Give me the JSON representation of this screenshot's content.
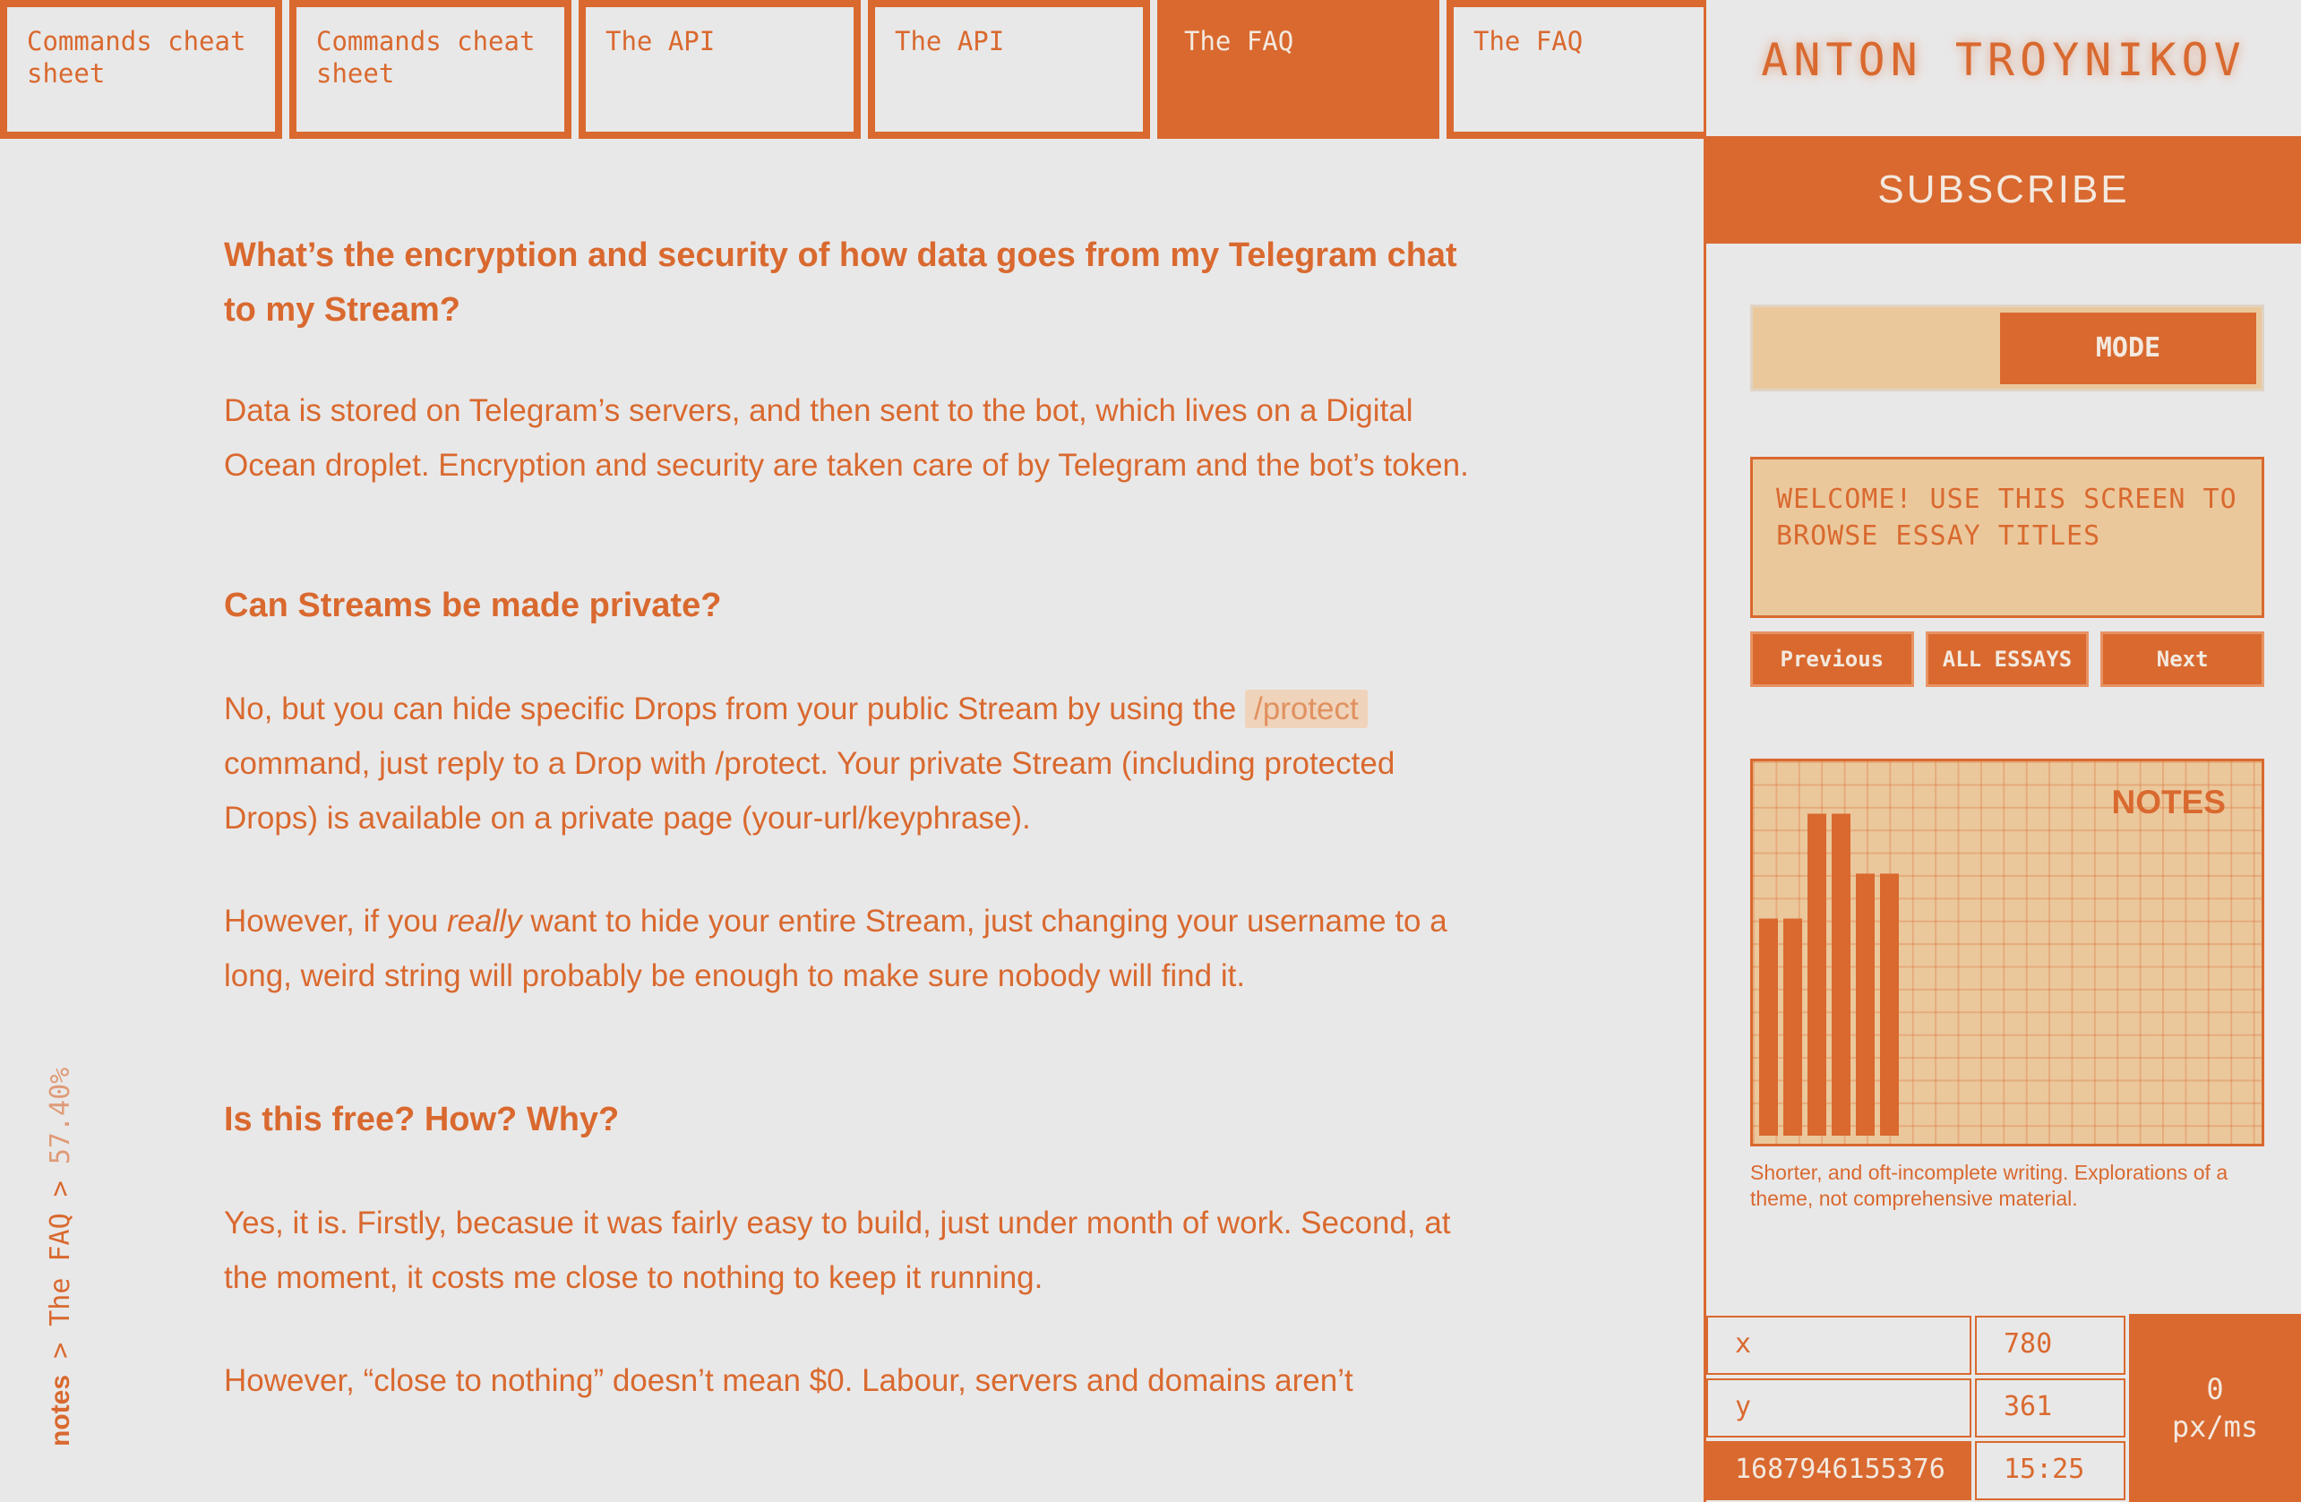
{
  "tabs": [
    {
      "label": "Commands cheat sheet",
      "active": false
    },
    {
      "label": "Commands cheat sheet",
      "active": false
    },
    {
      "label": "The API",
      "active": false
    },
    {
      "label": "The API",
      "active": false
    },
    {
      "label": "The FAQ",
      "active": true
    },
    {
      "label": "The FAQ",
      "active": false
    }
  ],
  "article": {
    "q1": "What’s the encryption and security of how data goes from my Telegram chat to my Stream?",
    "a1": "Data is stored on Telegram’s servers, and then sent to the bot, which lives on a Digital Ocean droplet. Encryption and security are taken care of by Telegram and the bot’s token.",
    "q2": "Can Streams be made private?",
    "a2_before": "No, but you can hide specific Drops from your public Stream by using the ",
    "a2_code": "/protect",
    "a2_after": " command, just reply to a Drop with /protect. Your private Stream (including protected Drops) is available on a private page (your-url/keyphrase).",
    "a3_before": "However, if you ",
    "a3_em": "really",
    "a3_after": " want to hide your entire Stream, just changing your username to a long, weird string will probably be enough to make sure nobody will find it.",
    "q3": "Is this free? How? Why?",
    "a4": "Yes, it is. Firstly, becasue it was fairly easy to build, just under month of work. Second, at the moment, it costs me close to nothing to keep it running.",
    "a5": "However, “close to nothing” doesn’t mean $0. Labour, servers and domains aren’t"
  },
  "breadcrumb": {
    "root": "notes",
    "sep1": " > ",
    "page": "The FAQ",
    "sep2": " > ",
    "progress": "57.40%"
  },
  "sidebar": {
    "author": "ANTON TROYNIKOV",
    "subscribe": "SUBSCRIBE",
    "mode_label": "MODE",
    "screen_text": "WELCOME! USE THIS SCREEN TO BROWSE ESSAY TITLES",
    "nav": {
      "previous": "Previous",
      "all": "ALL ESSAYS",
      "next": "Next"
    },
    "notes": {
      "title": "NOTES",
      "description": "Shorter, and oft-incomplete writing. Explorations of a theme, not comprehensive material.",
      "bars": [
        0.58,
        0.58,
        0.86,
        0.86,
        0.7,
        0.7
      ]
    }
  },
  "readout": {
    "x_label": "x",
    "x_value": "780",
    "y_label": "y",
    "y_value": "361",
    "timestamp": "1687946155376",
    "time": "15:25",
    "speed_value": "0",
    "speed_unit": "px/ms"
  },
  "colors": {
    "accent": "#d9692f",
    "accent_light": "#ebc89c",
    "background": "#e9e8e8"
  }
}
